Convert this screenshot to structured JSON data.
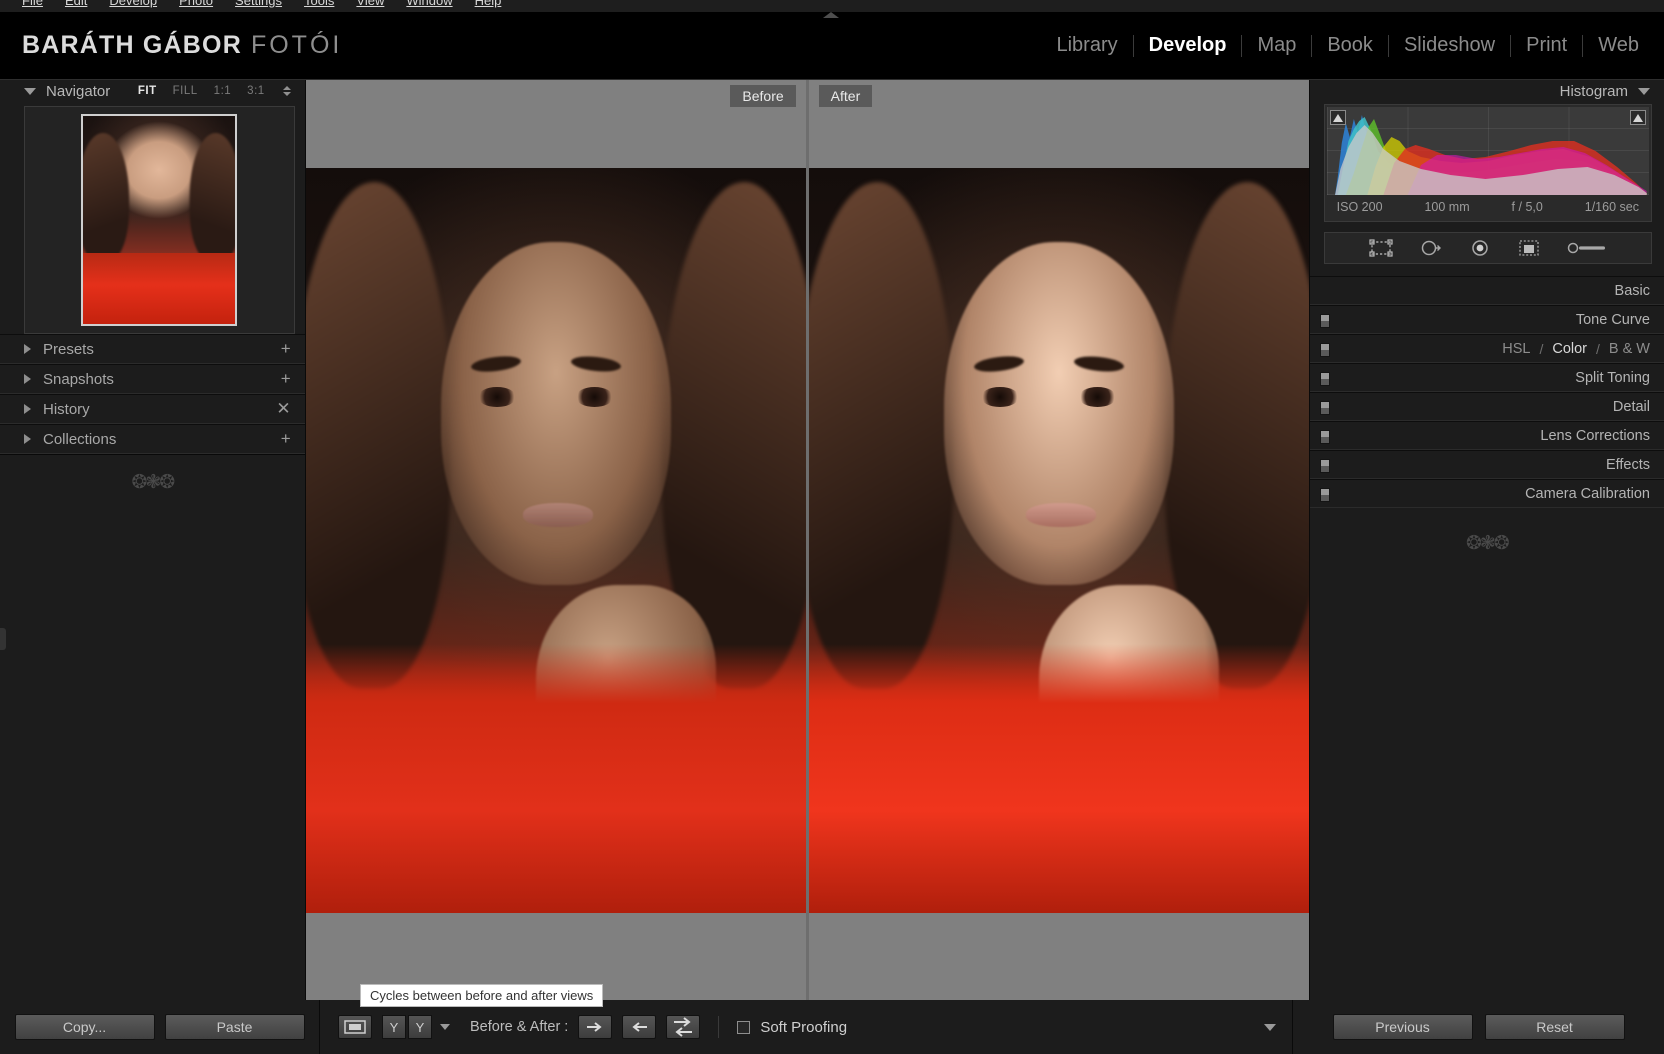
{
  "menu": {
    "items": [
      "File",
      "Edit",
      "Develop",
      "Photo",
      "Settings",
      "Tools",
      "View",
      "Window",
      "Help"
    ]
  },
  "brand": {
    "bold": "BARÁTH GÁBOR",
    "light": "FOTÓI"
  },
  "modules": {
    "items": [
      "Library",
      "Develop",
      "Map",
      "Book",
      "Slideshow",
      "Print",
      "Web"
    ],
    "active": "Develop"
  },
  "left_panel": {
    "navigator": {
      "title": "Navigator",
      "zoom_levels": [
        "FIT",
        "FILL",
        "1:1",
        "3:1"
      ],
      "active_zoom": "FIT"
    },
    "sections": [
      {
        "label": "Presets",
        "action": "+"
      },
      {
        "label": "Snapshots",
        "action": "+"
      },
      {
        "label": "History",
        "action": "✕"
      },
      {
        "label": "Collections",
        "action": "+"
      }
    ]
  },
  "center": {
    "before_label": "Before",
    "after_label": "After"
  },
  "right_panel": {
    "histogram": {
      "title": "Histogram",
      "exif": {
        "iso": "ISO 200",
        "focal_length": "100 mm",
        "aperture": "f / 5,0",
        "shutter": "1/160 sec"
      }
    },
    "tools": [
      "crop-overlay-icon",
      "spot-removal-icon",
      "red-eye-icon",
      "graduated-filter-icon",
      "adjustment-brush-icon"
    ],
    "modules": [
      {
        "name": "Basic",
        "type": "simple"
      },
      {
        "name": "Tone Curve",
        "type": "simple"
      },
      {
        "name": "HSL / Color / B & W",
        "type": "hsl",
        "segments": [
          "HSL",
          "Color",
          "B & W"
        ],
        "active_segment": "Color",
        "separator": "/"
      },
      {
        "name": "Split Toning",
        "type": "simple"
      },
      {
        "name": "Detail",
        "type": "simple"
      },
      {
        "name": "Lens Corrections",
        "type": "simple"
      },
      {
        "name": "Effects",
        "type": "simple"
      },
      {
        "name": "Camera Calibration",
        "type": "simple"
      }
    ]
  },
  "bottom_bar": {
    "copy_label": "Copy...",
    "paste_label": "Paste",
    "previous_label": "Previous",
    "reset_label": "Reset",
    "before_after_label": "Before & After :",
    "soft_proofing_label": "Soft Proofing",
    "yy_left": "Y",
    "yy_right": "Y",
    "tooltip": "Cycles between before and after views"
  },
  "colors": {
    "panel_bg": "#1c1c1c",
    "canvas_bg": "#808080",
    "topbar_bg": "#000000",
    "active_text": "#ffffff",
    "muted_text": "#8b8b8b",
    "accent_red": "#e7301a"
  }
}
